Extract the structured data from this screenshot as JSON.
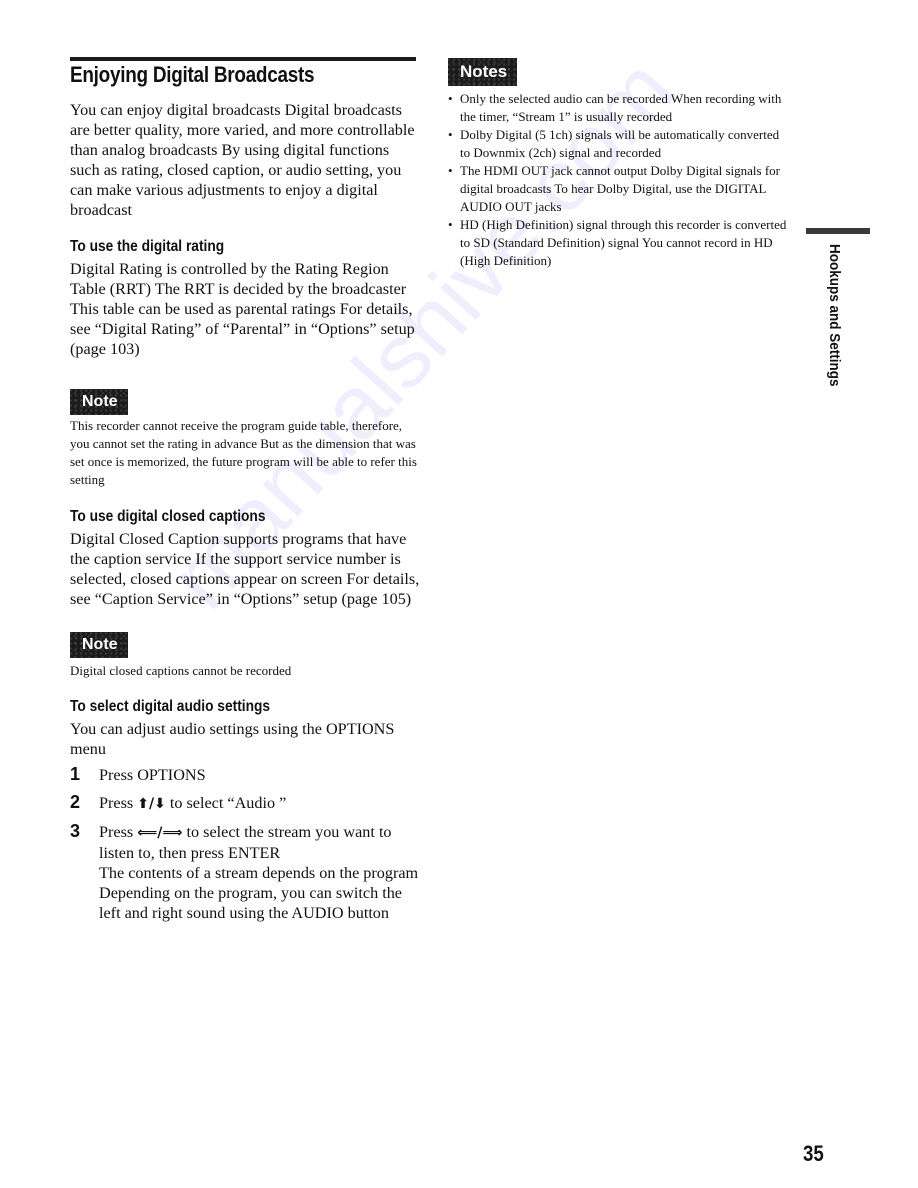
{
  "page": {
    "title": "Enjoying Digital Broadcasts",
    "intro": "You can enjoy digital broadcasts  Digital broadcasts are better quality, more varied, and more controllable than analog broadcasts  By using digital functions such as rating, closed caption, or audio setting, you can make various adjustments to enjoy a digital broadcast",
    "page_number": "35",
    "side_tab": "Hookups and Settings",
    "watermark": "manualshive.com"
  },
  "sections": {
    "rating": {
      "heading": "To use the digital rating",
      "body": "Digital Rating is controlled by the Rating Region Table (RRT)  The RRT is decided by the broadcaster  This table can be used as parental ratings  For details, see “Digital Rating” of “Parental” in “Options” setup (page 103)",
      "note_label": "Note",
      "note": "This recorder cannot receive the program guide table, therefore, you cannot set the rating in advance  But as the dimension that was set once is memorized, the future program will be able to refer this setting"
    },
    "captions": {
      "heading": "To use digital closed captions",
      "body": "Digital Closed Caption supports programs that have the caption service  If the support service number is selected, closed captions appear on screen  For details, see “Caption Service” in “Options” setup (page 105)",
      "note_label": "Note",
      "note": "Digital closed captions cannot be recorded"
    },
    "audio": {
      "heading": "To select digital audio settings",
      "body": "You can adjust audio settings using the OPTIONS menu",
      "steps": [
        {
          "num": "1",
          "text": "Press OPTIONS"
        },
        {
          "num": "2",
          "pre": "Press ",
          "arrows": "⬆/⬇",
          "post": " to select “Audio ”"
        },
        {
          "num": "3",
          "pre": "Press ",
          "arrows": "⟸/⟹",
          "post": " to select the stream you want to listen to, then press ENTER",
          "extra1": "The contents of a stream depends on the program",
          "extra2": "Depending on the program, you can switch the left and right sound using the AUDIO button"
        }
      ]
    }
  },
  "notes": {
    "label": "Notes",
    "items": [
      "Only the selected audio can be recorded  When recording with the timer, “Stream 1” is usually recorded",
      "Dolby Digital (5 1ch) signals will be automatically converted to Downmix (2ch) signal and recorded",
      "The HDMI OUT jack cannot output Dolby Digital signals for digital broadcasts  To hear Dolby Digital, use the DIGITAL AUDIO OUT jacks",
      "HD (High Definition) signal through this recorder is converted to SD (Standard Definition) signal  You cannot record in HD (High Definition)"
    ],
    "bullet": "•"
  }
}
